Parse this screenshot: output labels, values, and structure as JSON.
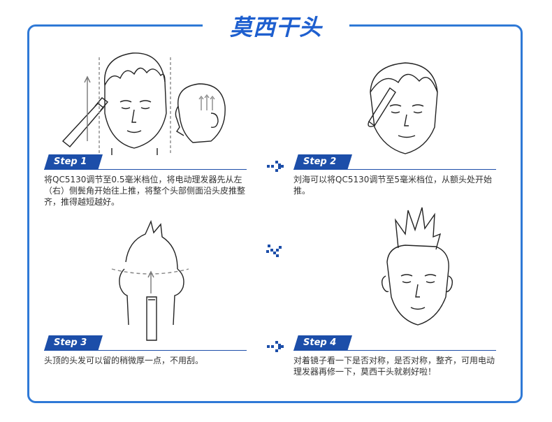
{
  "title": "莫西干头",
  "steps": [
    {
      "label": "Step 1",
      "text": "将QC5130调节至0.5毫米档位，将电动理发器先从左（右）侧鬓角开始往上推，将整个头部侧面沿头皮推整齐，推得越短越好。"
    },
    {
      "label": "Step 2",
      "text": "刘海可以将QC5130调节至5毫米档位，从额头处开始推。"
    },
    {
      "label": "Step 3",
      "text": "头顶的头发可以留的稍微厚一点，不用刮。"
    },
    {
      "label": "Step 4",
      "text": "对着镜子看一下是否对称，是否对称，整齐，可用电动理发器再修一下，莫西干头就剃好啦！"
    }
  ],
  "colors": {
    "accent": "#1c4ea9",
    "frame": "#2f79d6",
    "title": "#1e5fcf"
  },
  "icons": [
    "arrow-right-icon",
    "arrow-right-icon",
    "arrow-diagonal-icon"
  ]
}
